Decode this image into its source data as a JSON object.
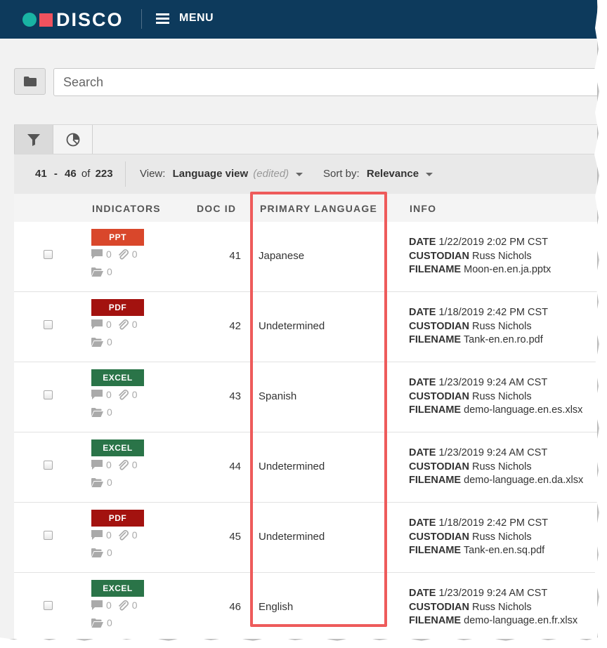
{
  "header": {
    "logo_text": "DISCO",
    "menu_label": "MENU",
    "colors": {
      "bar": "#0d3a5c",
      "logo_dot": "#19b3a3",
      "logo_square": "#f0525e"
    }
  },
  "search": {
    "placeholder": "Search"
  },
  "toolbar": {
    "range_start": "41",
    "range_sep": "-",
    "range_end": "46",
    "of_label": "of",
    "total": "223",
    "view_label": "View:",
    "view_value": "Language view",
    "view_edited": "(edited)",
    "sort_label": "Sort by:",
    "sort_value": "Relevance"
  },
  "columns": {
    "indicators": "INDICATORS",
    "doc_id": "DOC ID",
    "primary_language": "PRIMARY LANGUAGE",
    "info": "INFO"
  },
  "info_labels": {
    "date": "DATE",
    "custodian": "CUSTODIAN",
    "filename": "FILENAME"
  },
  "rows": [
    {
      "type": "PPT",
      "type_color": "#d9472b",
      "comments": "0",
      "attachments": "0",
      "folders": "0",
      "doc_id": "41",
      "language": "Japanese",
      "date": "1/22/2019 2:02 PM CST",
      "custodian": "Russ Nichols",
      "filename": "Moon-en.en.ja.pptx"
    },
    {
      "type": "PDF",
      "type_color": "#a3120f",
      "comments": "0",
      "attachments": "0",
      "folders": "0",
      "doc_id": "42",
      "language": "Undetermined",
      "date": "1/18/2019 2:42 PM CST",
      "custodian": "Russ Nichols",
      "filename": "Tank-en.en.ro.pdf"
    },
    {
      "type": "EXCEL",
      "type_color": "#2a7448",
      "comments": "0",
      "attachments": "0",
      "folders": "0",
      "doc_id": "43",
      "language": "Spanish",
      "date": "1/23/2019 9:24 AM CST",
      "custodian": "Russ Nichols",
      "filename": "demo-language.en.es.xlsx"
    },
    {
      "type": "EXCEL",
      "type_color": "#2a7448",
      "comments": "0",
      "attachments": "0",
      "folders": "0",
      "doc_id": "44",
      "language": "Undetermined",
      "date": "1/23/2019 9:24 AM CST",
      "custodian": "Russ Nichols",
      "filename": "demo-language.en.da.xlsx"
    },
    {
      "type": "PDF",
      "type_color": "#a3120f",
      "comments": "0",
      "attachments": "0",
      "folders": "0",
      "doc_id": "45",
      "language": "Undetermined",
      "date": "1/18/2019 2:42 PM CST",
      "custodian": "Russ Nichols",
      "filename": "Tank-en.en.sq.pdf"
    },
    {
      "type": "EXCEL",
      "type_color": "#2a7448",
      "comments": "0",
      "attachments": "0",
      "folders": "0",
      "doc_id": "46",
      "language": "English",
      "date": "1/23/2019 9:24 AM CST",
      "custodian": "Russ Nichols",
      "filename": "demo-language.en.fr.xlsx"
    }
  ],
  "highlight_color": "#ee5b5b"
}
